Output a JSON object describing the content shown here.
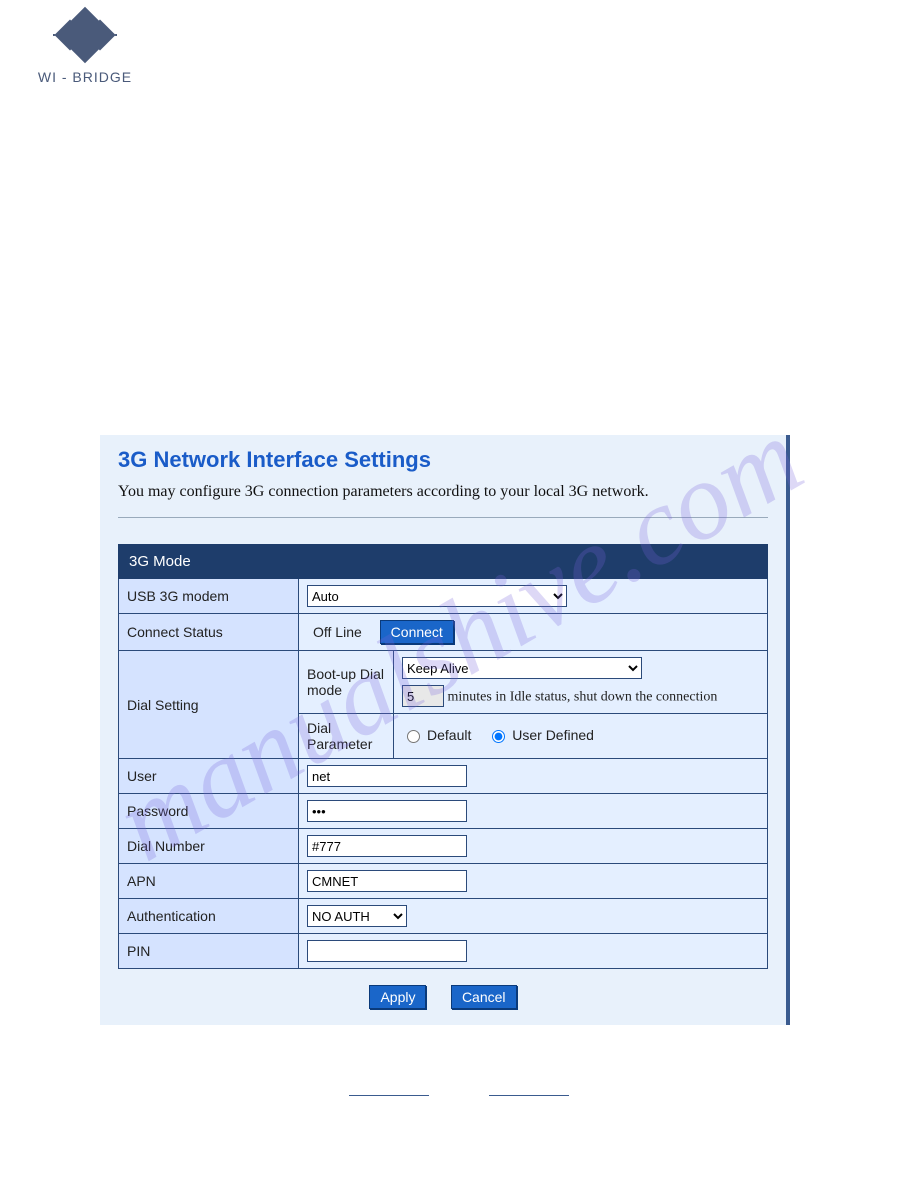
{
  "logo_text": "WI - BRIDGE",
  "watermark": "manualshive.com",
  "panel": {
    "title": "3G Network Interface Settings",
    "description": "You may configure 3G connection parameters according to your local 3G network."
  },
  "section_header": "3G Mode",
  "labels": {
    "usb_modem": "USB 3G modem",
    "connect_status": "Connect Status",
    "dial_setting": "Dial Setting",
    "bootup": "Boot-up Dial mode",
    "dial_param": "Dial Parameter",
    "user": "User",
    "password": "Password",
    "dial_number": "Dial Number",
    "apn": "APN",
    "auth": "Authentication",
    "pin": "PIN"
  },
  "values": {
    "usb_modem": "Auto",
    "connect_status_text": "Off Line",
    "connect_btn": "Connect",
    "keep_alive_select": "Keep Alive",
    "idle_minutes": "5",
    "idle_suffix": "minutes in Idle status, shut down the connection",
    "radio_default": "Default",
    "radio_user_defined": "User Defined",
    "radio_selected": "user",
    "user": "net",
    "password": "•••",
    "dial_number": "#777",
    "apn": "CMNET",
    "auth": "NO AUTH",
    "pin": ""
  },
  "buttons": {
    "apply": "Apply",
    "cancel": "Cancel"
  }
}
